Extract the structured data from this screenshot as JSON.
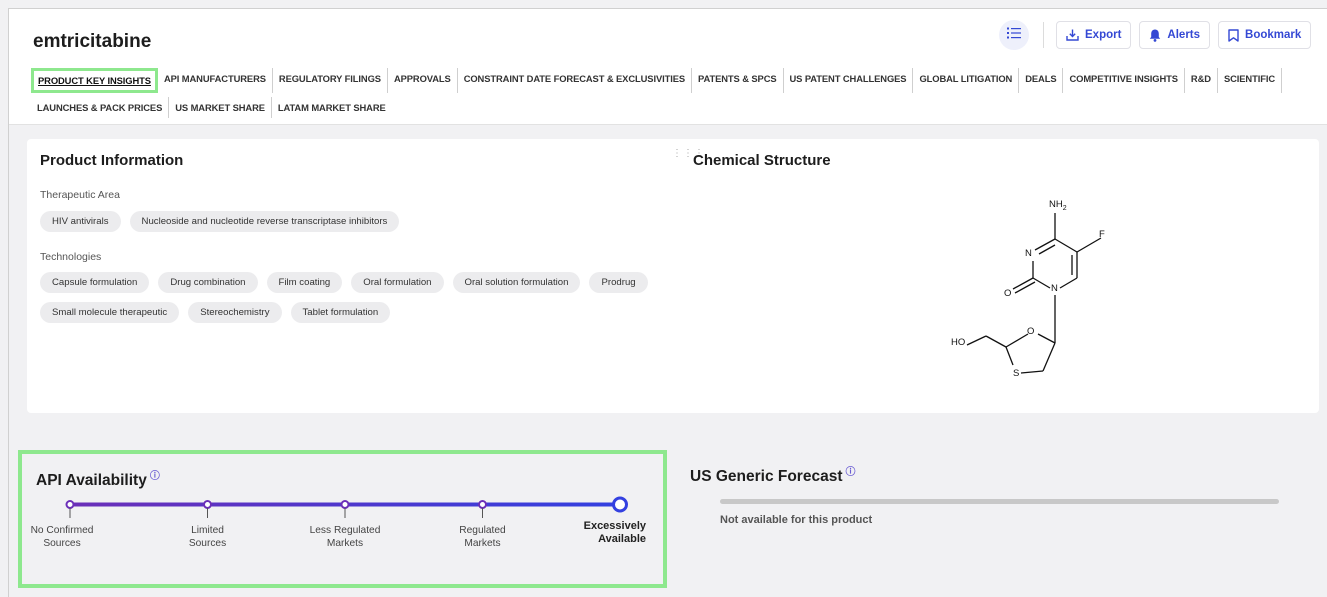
{
  "product": {
    "title": "emtricitabine"
  },
  "toolbar": {
    "list_icon": "list-icon",
    "export_label": "Export",
    "alerts_label": "Alerts",
    "bookmark_label": "Bookmark",
    "accent_color": "#3448d4"
  },
  "tabs": [
    "PRODUCT KEY INSIGHTS",
    "API MANUFACTURERS",
    "REGULATORY FILINGS",
    "APPROVALS",
    "CONSTRAINT DATE FORECAST & EXCLUSIVITIES",
    "PATENTS & SPCS",
    "US PATENT CHALLENGES",
    "GLOBAL LITIGATION",
    "DEALS",
    "COMPETITIVE INSIGHTS",
    "R&D",
    "SCIENTIFIC",
    "LAUNCHES & PACK PRICES",
    "US MARKET SHARE",
    "LATAM MARKET SHARE"
  ],
  "active_tab": "PRODUCT KEY INSIGHTS",
  "product_info": {
    "title": "Product Information",
    "therapeutic_area_label": "Therapeutic Area",
    "therapeutic_areas": [
      "HIV antivirals",
      "Nucleoside and nucleotide reverse transcriptase inhibitors"
    ],
    "technologies_label": "Technologies",
    "technologies": [
      "Capsule formulation",
      "Drug combination",
      "Film coating",
      "Oral formulation",
      "Oral solution formulation",
      "Prodrug",
      "Small molecule therapeutic",
      "Stereochemistry",
      "Tablet formulation"
    ]
  },
  "chemical_structure": {
    "title": "Chemical Structure",
    "atoms": {
      "nh2_n": "NH",
      "nh2_sub": "2",
      "f": "F",
      "n1": "N",
      "n2": "N",
      "o1": "O",
      "o2": "O",
      "ho": "HO",
      "s": "S"
    }
  },
  "api_availability": {
    "title": "API Availability",
    "info_icon": "info-icon",
    "levels": [
      "No Confirmed Sources",
      "Limited Sources",
      "Less Regulated Markets",
      "Regulated Markets",
      "Excessively Available"
    ],
    "level_lines": [
      [
        "No Confirmed",
        "Sources"
      ],
      [
        "Limited",
        "Sources"
      ],
      [
        "Less Regulated",
        "Markets"
      ],
      [
        "Regulated",
        "Markets"
      ],
      [
        "Excessively",
        "Available"
      ]
    ],
    "current_level": "Excessively Available",
    "gradient_start": "#6b2fb8",
    "gradient_end": "#3340e0"
  },
  "us_generic_forecast": {
    "title": "US Generic Forecast",
    "info_icon": "info-icon",
    "message": "Not available for this product"
  },
  "highlight_color": "#8ee88e"
}
